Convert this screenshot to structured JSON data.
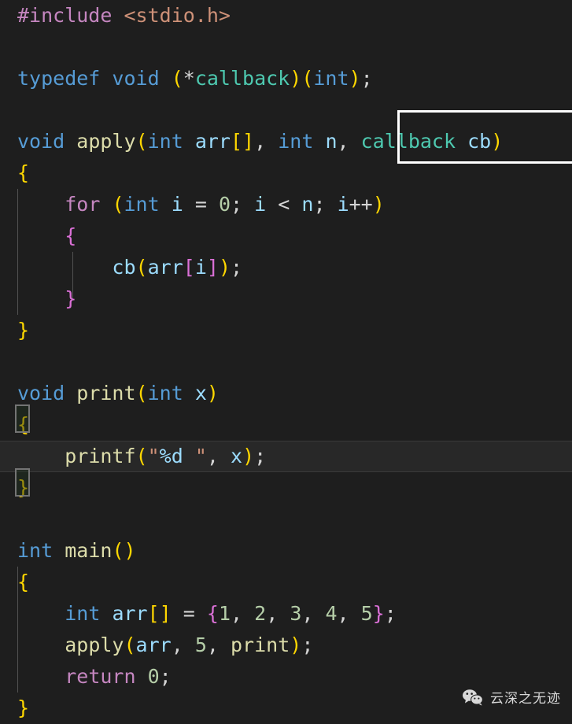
{
  "editor": {
    "language": "c",
    "background_color": "#1e1e1e",
    "default_text_color": "#d4d4d4",
    "font_size_px": 25,
    "line_height_px": 40,
    "theme": "Dark+ (default dark)"
  },
  "colors": {
    "keyword": "#569cd6",
    "control_keyword": "#c586c0",
    "function": "#dcdcaa",
    "type": "#4ec9b0",
    "variable": "#9cdcfe",
    "number": "#b5cea8",
    "string": "#ce9178",
    "bracket_level_1": "#ffd700",
    "bracket_level_2": "#da70d6",
    "bracket_level_3": "#179fff",
    "find_match_border": "#ffffff",
    "current_line_background": "#282828",
    "indent_guide": "#5a5a5a",
    "bracket_match_border": "#747474"
  },
  "code": {
    "lines": [
      "#include <stdio.h>",
      "",
      "typedef void (*callback)(int);",
      "",
      "void apply(int arr[], int n, callback cb)",
      "{",
      "    for (int i = 0; i < n; i++)",
      "    {",
      "        cb(arr[i]);",
      "    }",
      "}",
      "",
      "void print(int x)",
      "{",
      "    printf(\"%d \", x);",
      "}",
      "",
      "int main()",
      "{",
      "    int arr[] = {1, 2, 3, 4, 5};",
      "    apply(arr, 5, print);",
      "    return 0;",
      "}"
    ]
  },
  "tokens": {
    "l1": {
      "include": "#include",
      "header": "<stdio.h>"
    },
    "l3": {
      "typedef": "typedef",
      "void": "void",
      "lparen": "(",
      "star": "*",
      "callback": "callback",
      "rparen": ")",
      "lparen2": "(",
      "int": "int",
      "rparen2": ")",
      "semi": ";"
    },
    "l5": {
      "void": "void",
      "apply": "apply",
      "lparen": "(",
      "int1": "int",
      "arr": "arr",
      "lbracket": "[",
      "rbracket": "]",
      "comma1": ", ",
      "int2": "int",
      "n": "n",
      "comma2": ", ",
      "callback": "callback",
      "cb": "cb",
      "rparen": ")"
    },
    "l6": {
      "brace": "{"
    },
    "l7": {
      "for": "for",
      "lparen": "(",
      "int": "int",
      "i": "i",
      "eq": "=",
      "zero": "0",
      "semi1": "; ",
      "i2": "i",
      "lt": "<",
      "n": "n",
      "semi2": "; ",
      "i3": "i",
      "inc": "++",
      "rparen": ")"
    },
    "l8": {
      "brace": "{"
    },
    "l9": {
      "cb": "cb",
      "lparen": "(",
      "arr": "arr",
      "lbracket": "[",
      "i": "i",
      "rbracket": "]",
      "rparen": ")",
      "semi": ";"
    },
    "l10": {
      "brace": "}"
    },
    "l11": {
      "brace": "}"
    },
    "l13": {
      "void": "void",
      "print": "print",
      "lparen": "(",
      "int": "int",
      "x": "x",
      "rparen": ")"
    },
    "l14": {
      "brace": "{"
    },
    "l15": {
      "printf": "printf",
      "lparen": "(",
      "quote1": "\"",
      "fmt": "%d",
      "space": " ",
      "quote2": "\"",
      "comma": ", ",
      "x": "x",
      "rparen": ")",
      "semi": ";"
    },
    "l16": {
      "brace": "}"
    },
    "l18": {
      "int": "int",
      "main": "main",
      "lparen": "(",
      "rparen": ")"
    },
    "l19": {
      "brace": "{"
    },
    "l20": {
      "int": "int",
      "arr": "arr",
      "lbracket": "[",
      "rbracket": "]",
      "eq": "=",
      "lbrace": "{",
      "n1": "1",
      "c1": ", ",
      "n2": "2",
      "c2": ", ",
      "n3": "3",
      "c3": ", ",
      "n4": "4",
      "c4": ", ",
      "n5": "5",
      "rbrace": "}",
      "semi": ";"
    },
    "l21": {
      "apply": "apply",
      "lparen": "(",
      "arr": "arr",
      "comma1": ", ",
      "five": "5",
      "comma2": ", ",
      "print": "print",
      "rparen": ")",
      "semi": ";"
    },
    "l22": {
      "return": "return",
      "zero": "0",
      "semi": ";"
    },
    "l23": {
      "brace": "}"
    }
  },
  "decorations": {
    "find_match": {
      "text": "callback cb)",
      "line": 5
    },
    "current_line": {
      "line": 15,
      "text": "    printf(\"%d \", x);"
    },
    "bracket_match": {
      "open_line": 14,
      "close_line": 16,
      "character": "{"
    }
  },
  "watermark": {
    "account_name": "云深之无迹",
    "icon": "wechat-icon"
  }
}
